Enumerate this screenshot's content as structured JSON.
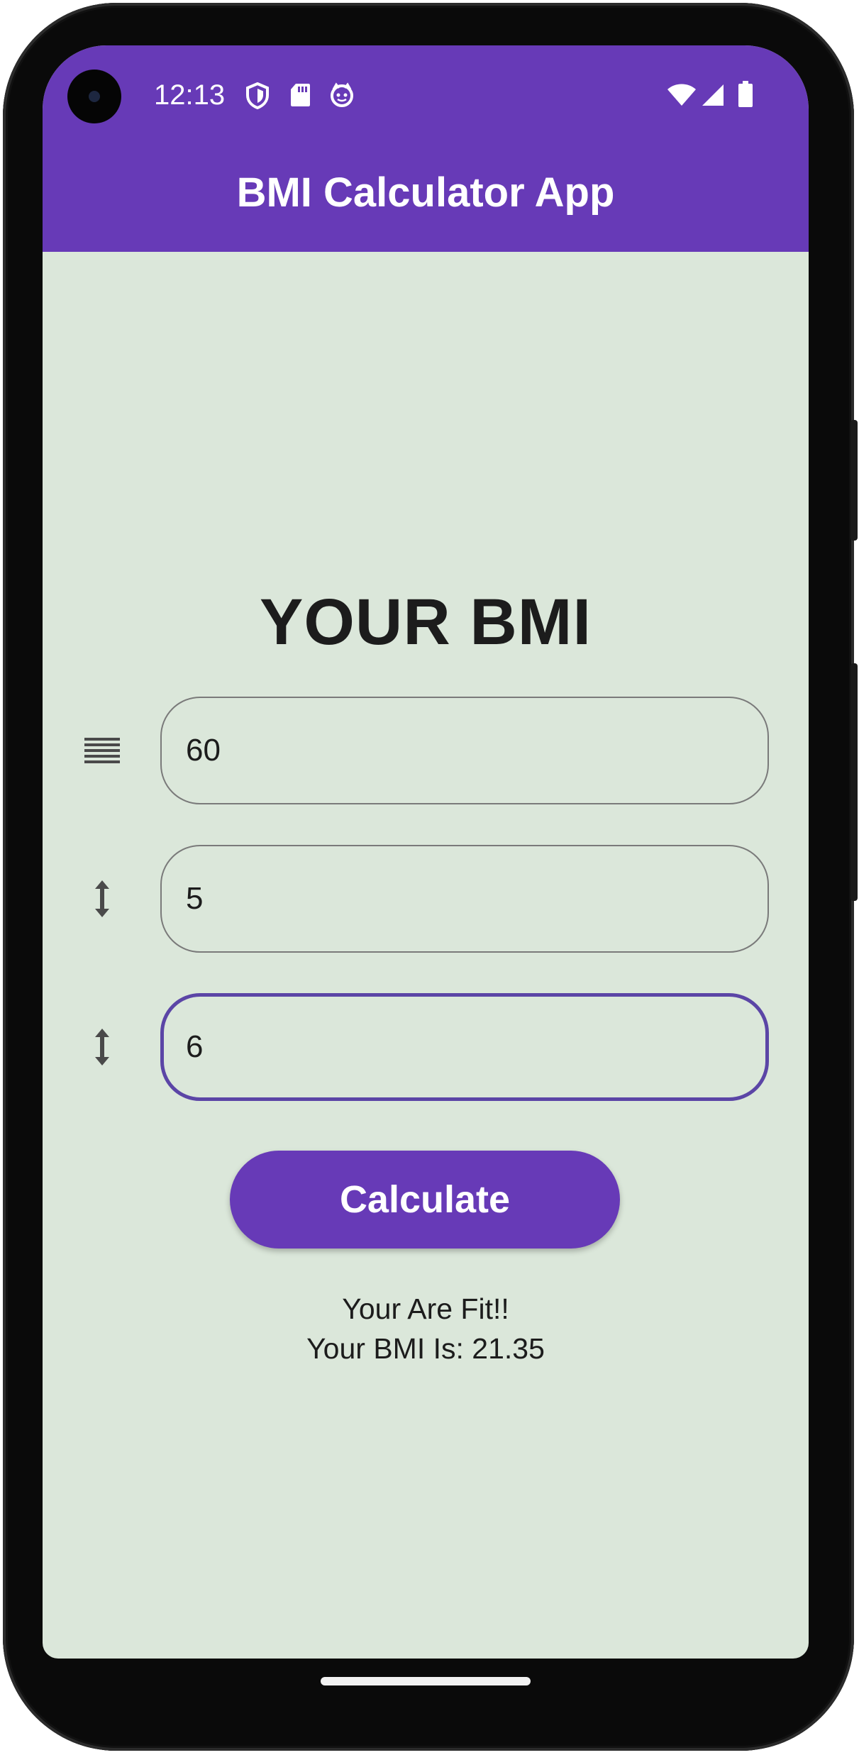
{
  "status_bar": {
    "time": "12:13",
    "left_icons": [
      "shield-icon",
      "sd-card-icon",
      "face-icon"
    ],
    "right_icons": [
      "wifi-icon",
      "signal-icon",
      "battery-icon"
    ]
  },
  "app_bar": {
    "title": "BMI Calculator App",
    "color": "#673ab7"
  },
  "main": {
    "headline": "YOUR BMI",
    "background_color": "#dbe7da",
    "fields": [
      {
        "icon": "weight-lines-icon",
        "value": "60",
        "focused": false
      },
      {
        "icon": "height-arrows-icon",
        "value": "5",
        "focused": false
      },
      {
        "icon": "height-arrows-icon",
        "value": "6",
        "focused": true
      }
    ],
    "calculate_label": "Calculate",
    "result_status": "Your Are Fit!!",
    "result_value": "Your BMI Is: 21.35"
  }
}
